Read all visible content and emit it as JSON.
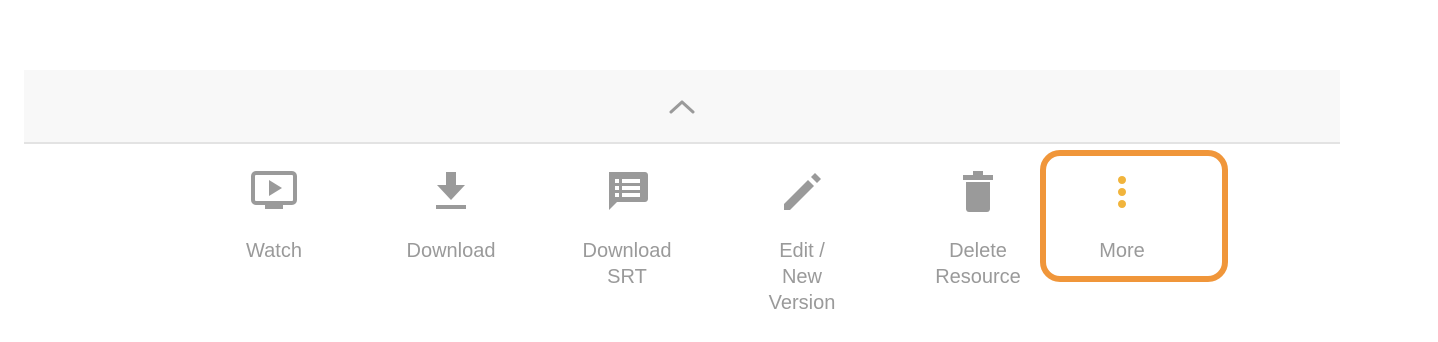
{
  "toolbar": {
    "collapse_icon": "chevron-up-icon",
    "accent_color": "#f0963a",
    "icon_color": "#9a9a9a",
    "more_dots_color": "#f1b43c",
    "actions": [
      {
        "label": "Watch",
        "icon": "watch-icon"
      },
      {
        "label": "Download",
        "icon": "download-icon"
      },
      {
        "label": "Download\nSRT",
        "icon": "srt-icon"
      },
      {
        "label": "Edit /\nNew\nVersion",
        "icon": "pencil-icon"
      },
      {
        "label": "Delete\nResource",
        "icon": "trash-icon"
      },
      {
        "label": "More",
        "icon": "more-vertical-icon"
      }
    ]
  }
}
